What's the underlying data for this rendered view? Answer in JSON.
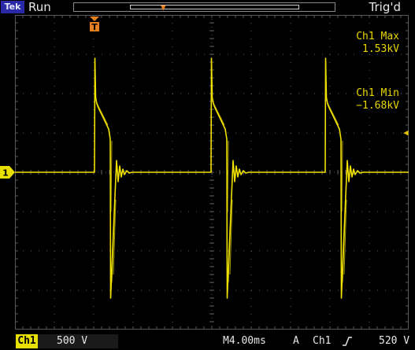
{
  "header": {
    "brand": "Tek",
    "run_state": "Run",
    "trigger_status": "Trig'd"
  },
  "measurements": [
    {
      "label": "Ch1 Max",
      "value": "1.53kV"
    },
    {
      "label": "Ch1 Min",
      "value": "−1.68kV"
    }
  ],
  "markers": {
    "trigger_position": "T",
    "channel_ref": "1"
  },
  "footer": {
    "channel": "Ch1",
    "volts_per_div": "500 V",
    "timebase": "M4.00ms",
    "acq_mode": "A",
    "trigger_source": "Ch1",
    "trigger_level": "520 V"
  },
  "colors": {
    "trace": "#f0e000",
    "grid": "#5a5a5a",
    "text": "#e8e8e8",
    "trigger_marker": "#e88020"
  },
  "icons": {
    "slope": "rising-edge-icon",
    "trigger_level": "left-arrow-icon"
  }
}
